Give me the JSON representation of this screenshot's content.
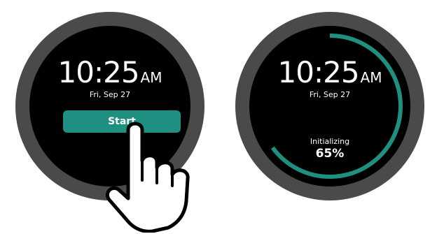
{
  "colors": {
    "bezel": "#4a4a4a",
    "screen": "#000000",
    "accent": "#1f8f81",
    "text": "#ffffff",
    "track": "#2a2a2a"
  },
  "watch_idle": {
    "time": "10:25",
    "ampm": "AM",
    "date": "Fri, Sep 27",
    "start_label": "Start"
  },
  "watch_progress": {
    "time": "10:25",
    "ampm": "AM",
    "date": "Fri, Sep 27",
    "status_label": "Initializing",
    "status_value": "65%",
    "progress": 0.65
  },
  "icons": {
    "pointer": "hand-pointer-icon",
    "progress": "progress-ring-icon"
  }
}
